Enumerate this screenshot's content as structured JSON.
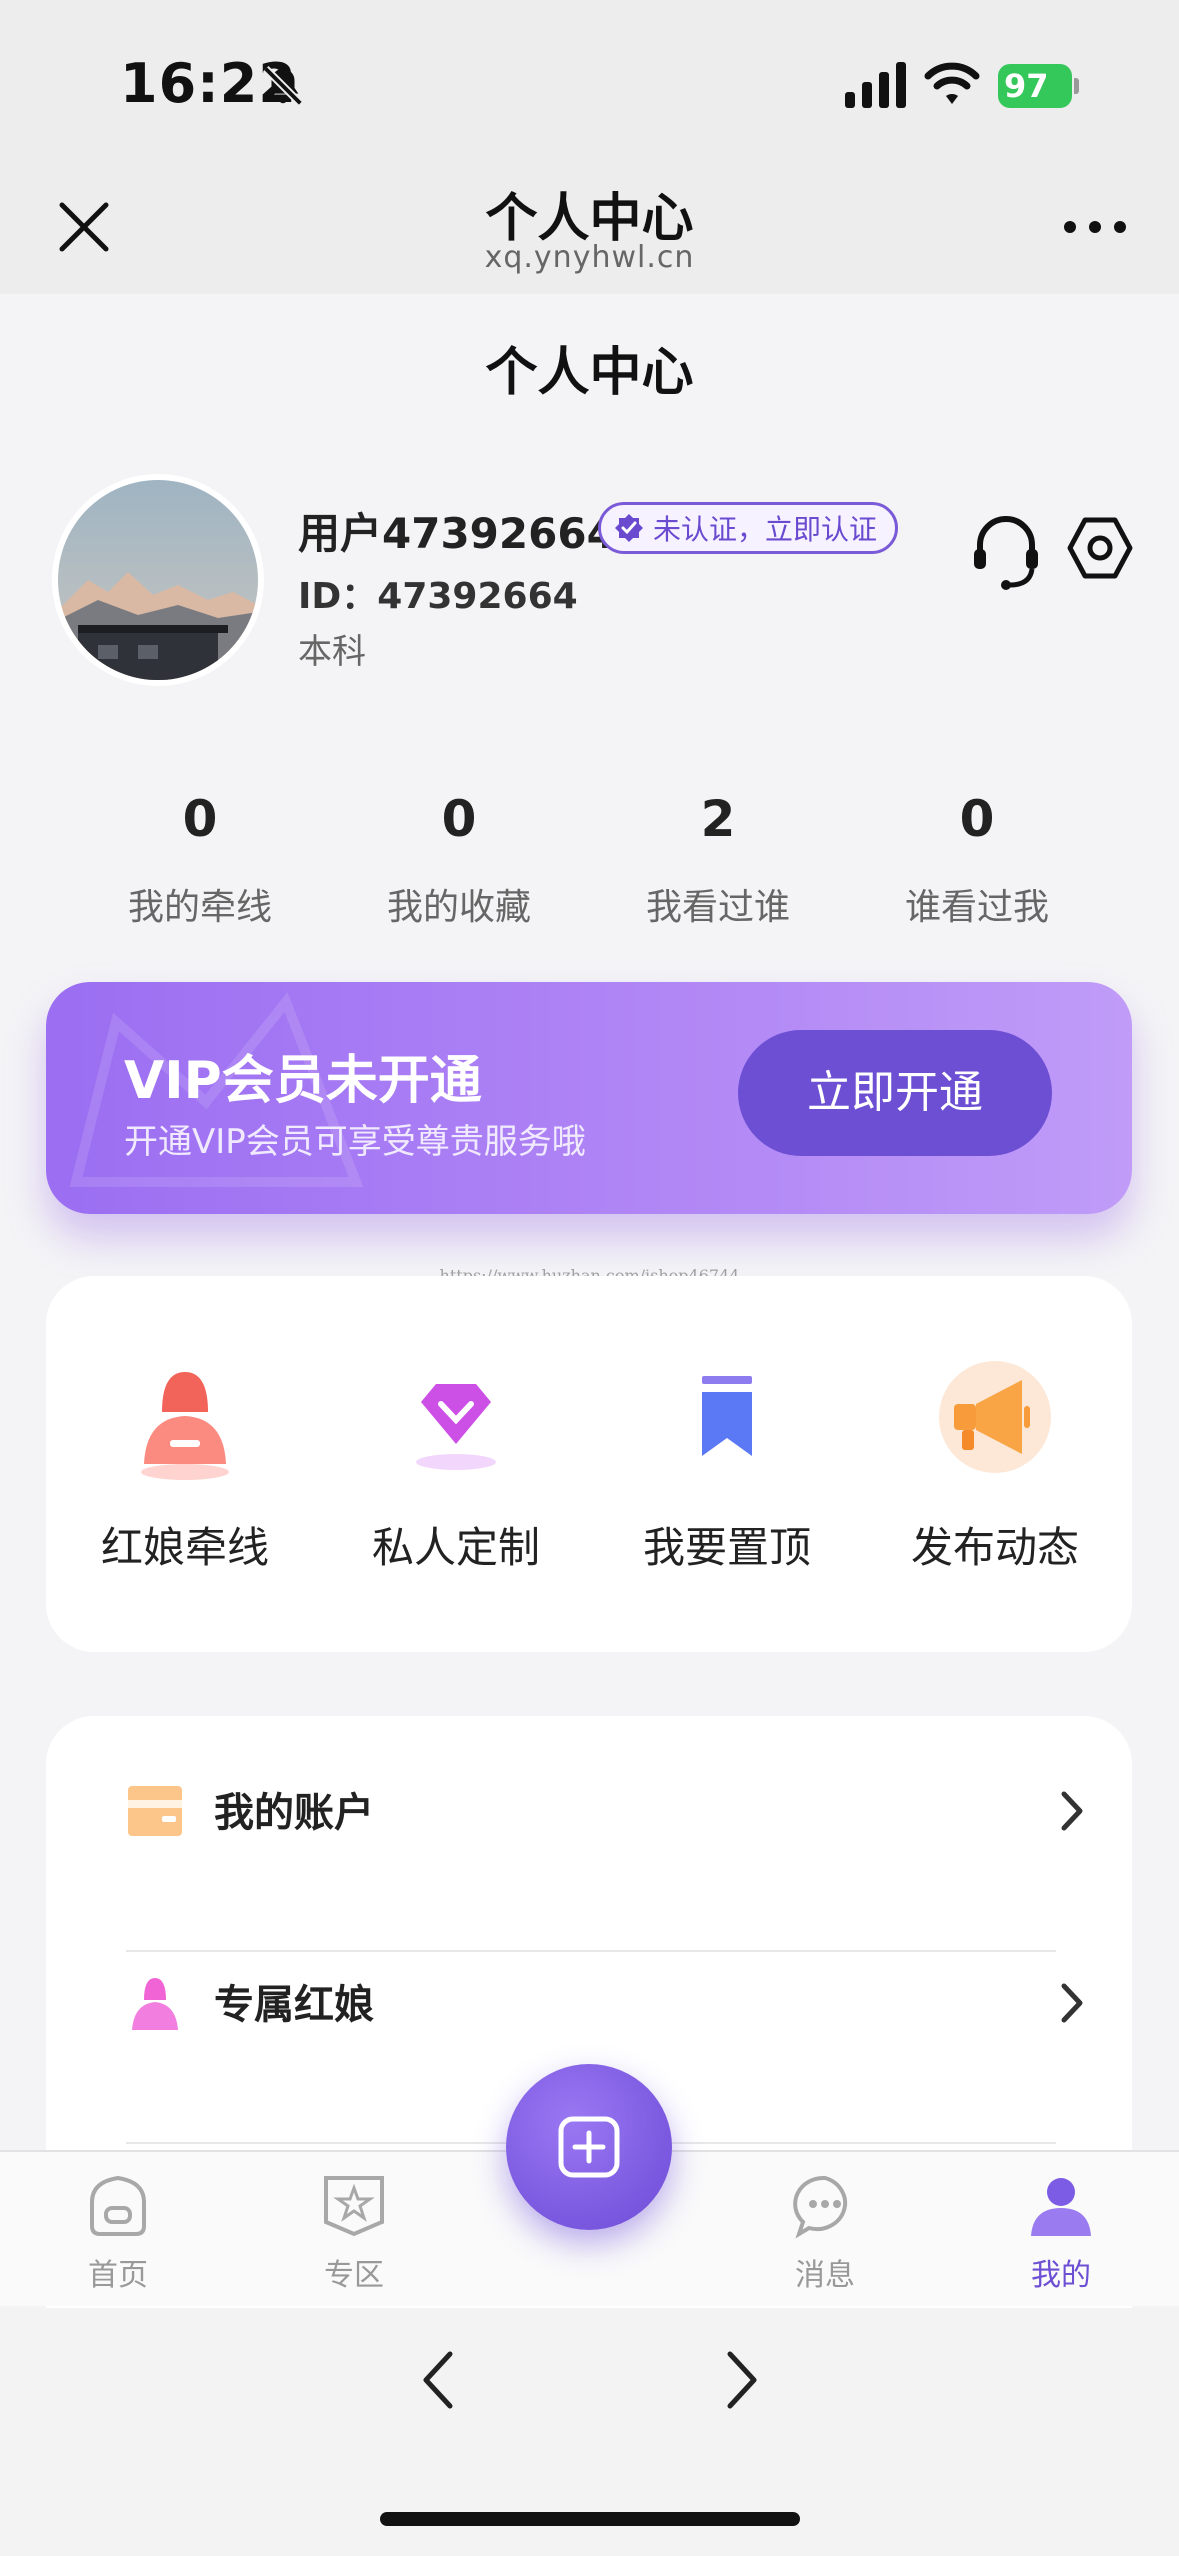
{
  "status_bar": {
    "time": "16:22",
    "battery": "97"
  },
  "browser": {
    "title": "个人中心",
    "domain": "xq.ynyhwl.cn"
  },
  "page": {
    "title": "个人中心"
  },
  "profile": {
    "username": "用户47392664",
    "verify_badge": "未认证，立即认证",
    "id": "ID：47392664",
    "education": "本科"
  },
  "stats": [
    {
      "value": "0",
      "label": "我的牵线"
    },
    {
      "value": "0",
      "label": "我的收藏"
    },
    {
      "value": "2",
      "label": "我看过谁"
    },
    {
      "value": "0",
      "label": "谁看过我"
    }
  ],
  "vip": {
    "title": "VIP会员未开通",
    "subtitle": "开通VIP会员可享受尊贵服务哦",
    "button": "立即开通"
  },
  "watermark": "https://www.huzhan.com/ishop46744",
  "actions": [
    {
      "label": "红娘牵线",
      "icon": "matchmaker-icon"
    },
    {
      "label": "私人定制",
      "icon": "diamond-icon"
    },
    {
      "label": "我要置顶",
      "icon": "bookmark-icon"
    },
    {
      "label": "发布动态",
      "icon": "megaphone-icon"
    }
  ],
  "menu": [
    {
      "label": "我的账户",
      "icon": "wallet-icon"
    },
    {
      "label": "专属红娘",
      "icon": "person-icon"
    }
  ],
  "tabs": [
    {
      "label": "首页",
      "icon": "home-icon",
      "active": false
    },
    {
      "label": "专区",
      "icon": "star-icon",
      "active": false
    },
    {
      "label": "消息",
      "icon": "message-icon",
      "active": false
    },
    {
      "label": "我的",
      "icon": "user-icon",
      "active": true
    }
  ],
  "colors": {
    "accent": "#6d4fd4",
    "vip_gradient_start": "#9b6ef2",
    "vip_gradient_end": "#c09cf8",
    "battery": "#34c759"
  }
}
